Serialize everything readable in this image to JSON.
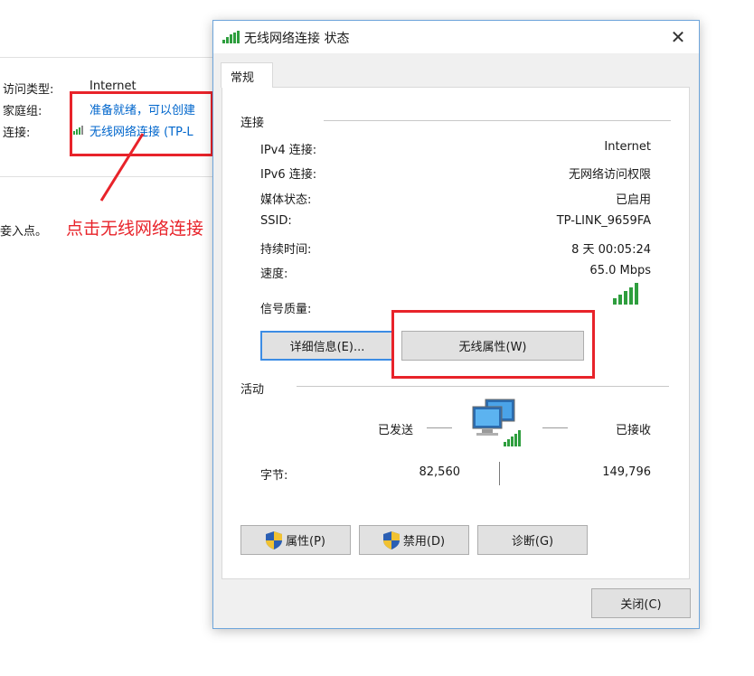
{
  "background": {
    "rows": [
      {
        "label": "访问类型:",
        "value": "Internet"
      },
      {
        "label": "家庭组:",
        "value": "准备就绪，可以创建"
      },
      {
        "label": "连接:",
        "value": "无线网络连接 (TP-L"
      }
    ],
    "truncated_text": "妾入点。"
  },
  "annotation": {
    "text": "点击无线网络连接",
    "color": "#e8232a"
  },
  "dialog": {
    "title": "无线网络连接 状态",
    "close_glyph": "✕",
    "tab_label": "常规",
    "connection": {
      "title": "连接",
      "rows": [
        {
          "label": "IPv4 连接:",
          "value": "Internet"
        },
        {
          "label": "IPv6 连接:",
          "value": "无网络访问权限"
        },
        {
          "label": "媒体状态:",
          "value": "已启用"
        },
        {
          "label": "SSID:",
          "value": "TP-LINK_9659FA"
        },
        {
          "label": "持续时间:",
          "value": "8 天 00:05:24"
        },
        {
          "label": "速度:",
          "value": "65.0 Mbps"
        }
      ],
      "signal_label": "信号质量:",
      "details_button": "详细信息(E)...",
      "wireless_props_button": "无线属性(W)"
    },
    "activity": {
      "title": "活动",
      "sent_label": "已发送",
      "received_label": "已接收",
      "bytes_label": "字节:",
      "bytes_sent": "82,560",
      "bytes_received": "149,796"
    },
    "buttons": {
      "properties": "属性(P)",
      "disable": "禁用(D)",
      "diagnose": "诊断(G)",
      "close": "关闭(C)"
    }
  },
  "colors": {
    "accent": "#0066cc",
    "highlight": "#e8232a",
    "signal": "#2e9e3e",
    "focus": "#3c8ce4"
  }
}
